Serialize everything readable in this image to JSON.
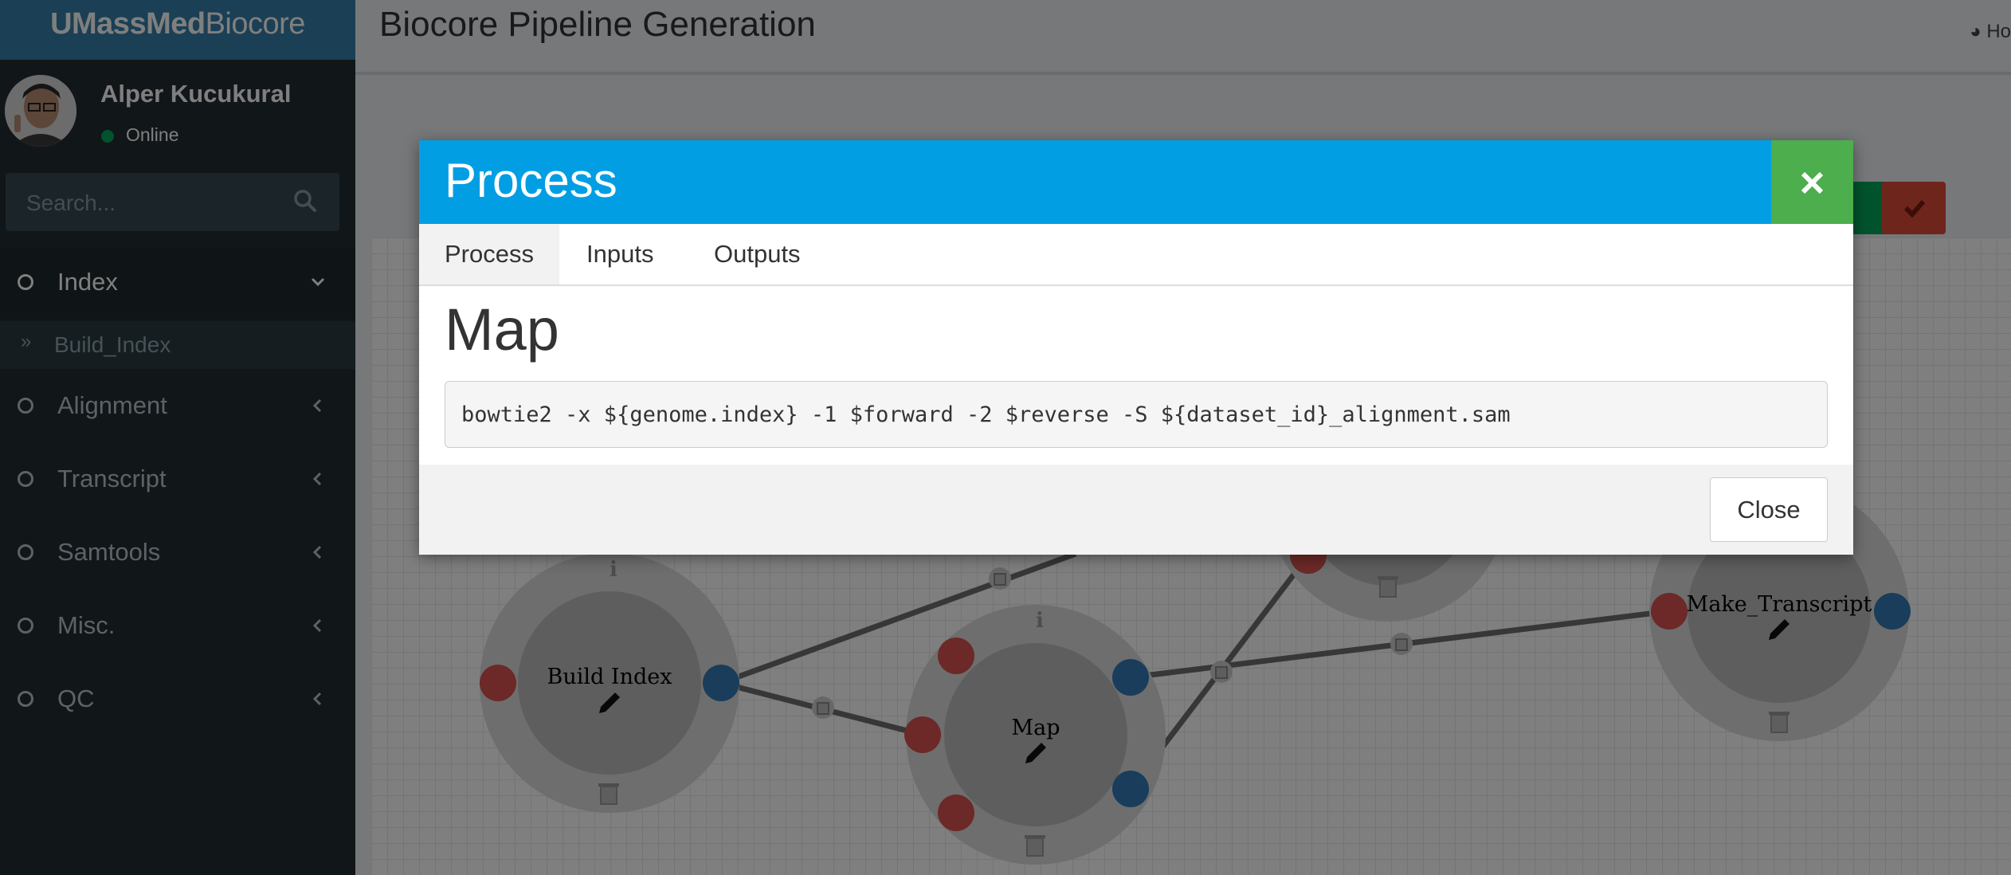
{
  "brand": {
    "part1": "UMassMed",
    "part2": "Biocore"
  },
  "user": {
    "name": "Alper Kucukural",
    "status": "Online"
  },
  "search": {
    "placeholder": "Search..."
  },
  "sidebar": {
    "items": [
      {
        "label": "Index",
        "expanded": true
      },
      {
        "label": "Alignment",
        "expanded": false
      },
      {
        "label": "Transcript",
        "expanded": false
      },
      {
        "label": "Samtools",
        "expanded": false
      },
      {
        "label": "Misc.",
        "expanded": false
      },
      {
        "label": "QC",
        "expanded": false
      }
    ],
    "sub_items": [
      {
        "label": "Build_Index"
      }
    ]
  },
  "header": {
    "title": "Biocore Pipeline Generation",
    "home_link": "Ho"
  },
  "workflow": {
    "nodes": [
      {
        "name": "Build Index"
      },
      {
        "name": "Map"
      },
      {
        "name": "Make_Transcript"
      }
    ]
  },
  "modal": {
    "title": "Process",
    "tabs": [
      {
        "label": "Process",
        "active": true
      },
      {
        "label": "Inputs",
        "active": false
      },
      {
        "label": "Outputs",
        "active": false
      }
    ],
    "process_name": "Map",
    "command": "bowtie2 -x ${genome.index} -1 $forward -2 $reverse -S ${dataset_id}_alignment.sam",
    "close_label": "Close"
  },
  "colors": {
    "sidebar_bg": "#222d32",
    "logo_bg": "#367fa9",
    "modal_header": "#019ee4",
    "close_x_bg": "#4cae4c",
    "input_port": "#d9534f",
    "output_port": "#337ab7",
    "online": "#00a65a"
  },
  "icons": {
    "search": "search-icon",
    "close": "close-icon",
    "edit": "pencil-icon",
    "delete": "trash-icon",
    "info": "info-icon",
    "home": "dashboard-icon"
  }
}
